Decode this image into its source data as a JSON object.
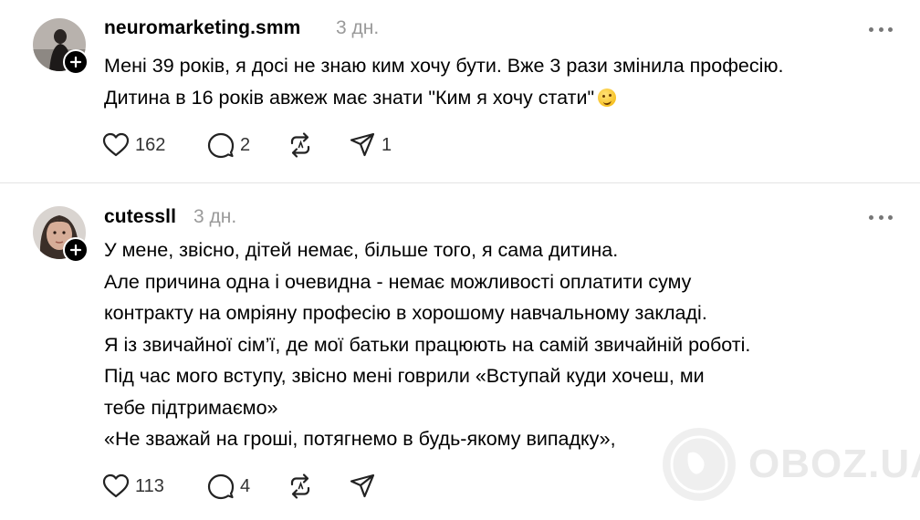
{
  "posts": [
    {
      "username": "neuromarketing.smm",
      "time": "3 дн.",
      "lines": [
        "Мені 39 років, я досі не знаю ким хочу бути. Вже 3 рази змінила професію.",
        "Дитина в 16 років авжеж має знати \"Ким я хочу стати\""
      ],
      "likes": "162",
      "comments": "2",
      "shares": "1"
    },
    {
      "username": "cutessll",
      "time": "3 дн.",
      "lines": [
        "У мене, звісно, дітей немає, більше того, я сама дитина.",
        "Але причина одна і очевидна - немає можливості оплатити суму",
        "контракту на омріяну професію в хорошому навчальному закладі.",
        "Я із звичайної сім’ї, де мої батьки працюють на самій звичайній роботі.",
        "Під час мого вступу, звісно мені говрили «Вступай куди хочеш, ми",
        "тебе підтримаємо»",
        "«Не зважай на гроші, потягнемо в будь-якому випадку»,"
      ],
      "likes": "113",
      "comments": "4",
      "shares": ""
    }
  ],
  "watermark": {
    "text": "OBOZ.UA"
  },
  "icons": {
    "like": "heart-icon",
    "comment": "comment-bubble-icon",
    "repost": "repost-icon",
    "share": "send-icon",
    "more": "more-dots-icon",
    "follow": "plus-icon"
  }
}
